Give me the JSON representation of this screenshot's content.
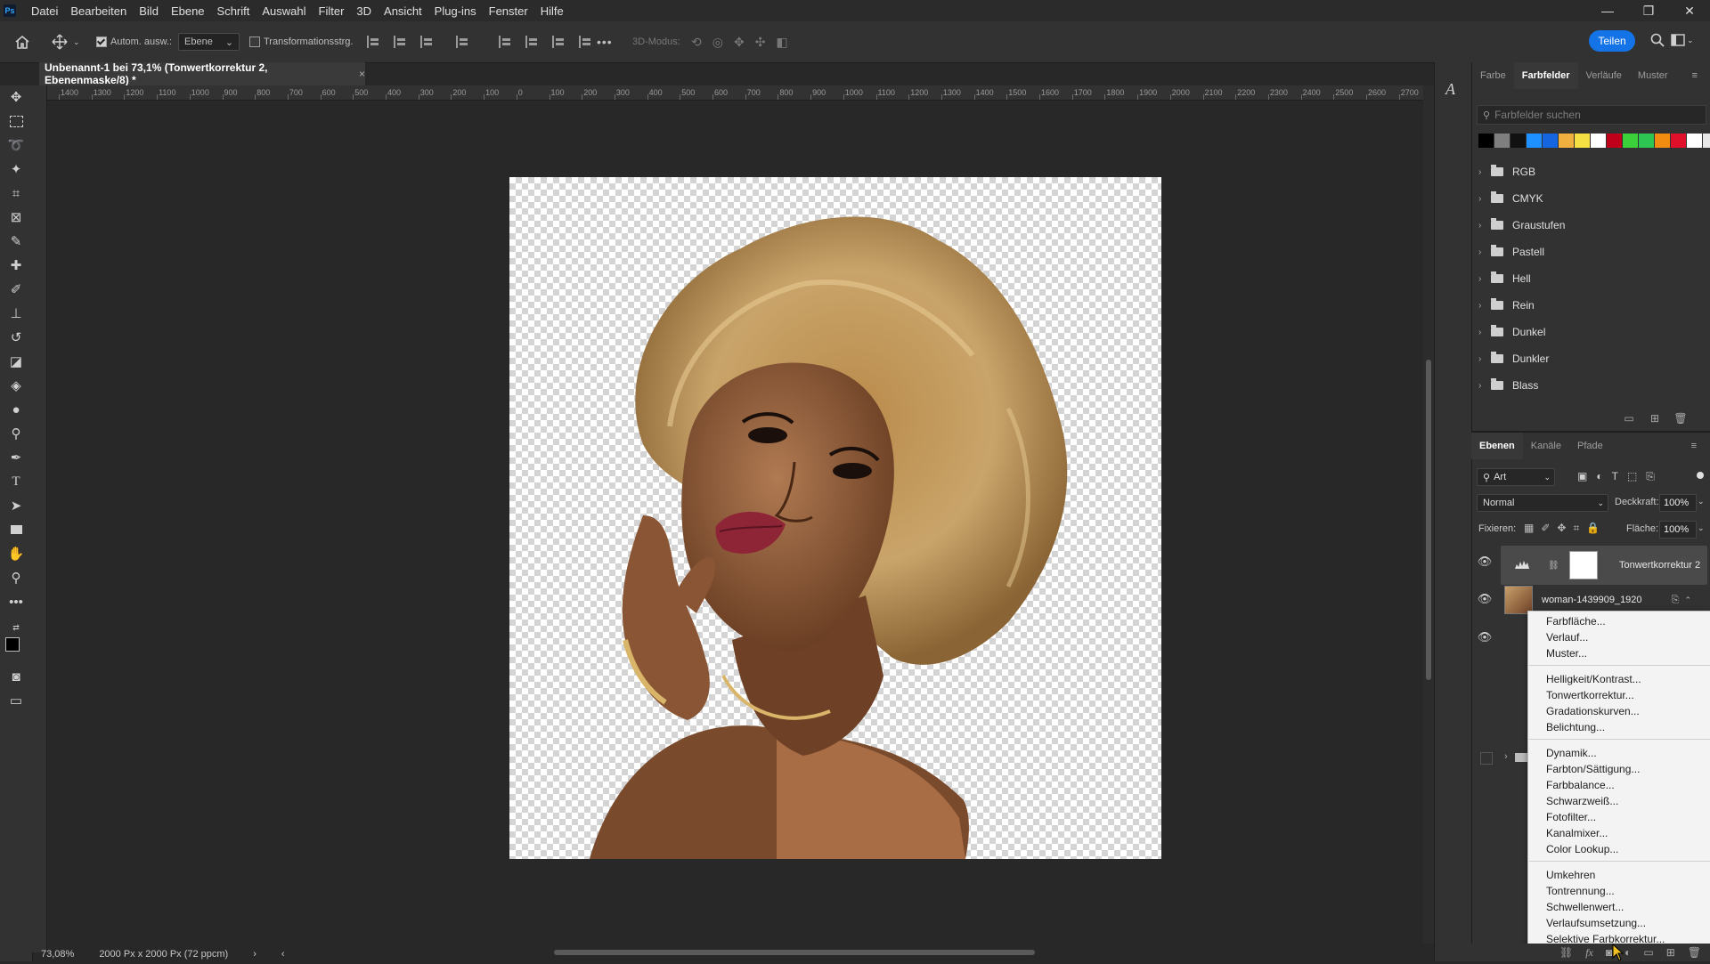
{
  "menubar": {
    "logo": "Ps",
    "items": [
      "Datei",
      "Bearbeiten",
      "Bild",
      "Ebene",
      "Schrift",
      "Auswahl",
      "Filter",
      "3D",
      "Ansicht",
      "Plug-ins",
      "Fenster",
      "Hilfe"
    ],
    "window_controls": [
      "—",
      "❐",
      "✕"
    ]
  },
  "options": {
    "auto_select_label": "Autom. ausw.:",
    "auto_select_checked": true,
    "auto_select_value": "Ebene",
    "transform_label": "Transformationsstrg.",
    "transform_checked": false,
    "more": "•••",
    "mode3d_label": "3D-Modus:",
    "share_label": "Teilen"
  },
  "document": {
    "tab_title": "Unbenannt-1 bei 73,1% (Tonwertkorrektur 2, Ebenenmaske/8) *",
    "close": "×",
    "zoom": "73,08%",
    "size_info": "2000 Px x 2000 Px (72 ppcm)",
    "status_arrow": "›",
    "scroll_left": "‹"
  },
  "ruler": {
    "h_labels": [
      "1400",
      "1300",
      "1200",
      "1100",
      "1000",
      "900",
      "800",
      "700",
      "600",
      "500",
      "400",
      "300",
      "200",
      "100",
      "0",
      "100",
      "200",
      "300",
      "400",
      "500",
      "600",
      "700",
      "800",
      "900",
      "1000",
      "1100",
      "1200",
      "1300",
      "1400",
      "1500",
      "1600",
      "1700",
      "1800",
      "1900",
      "2000",
      "2100",
      "2200",
      "2300",
      "2400",
      "2500",
      "2600",
      "2700"
    ]
  },
  "tools": [
    "move-tool",
    "marquee-tool",
    "lasso-tool",
    "magic-wand-tool",
    "crop-tool",
    "frame-tool",
    "eyedropper-tool",
    "healing-tool",
    "brush-tool",
    "stamp-tool",
    "history-brush-tool",
    "eraser-tool",
    "fill-tool",
    "blur-tool",
    "dodge-tool",
    "pen-tool",
    "type-tool",
    "path-select-tool",
    "rectangle-tool",
    "hand-tool",
    "zoom-tool",
    "more-tools"
  ],
  "swatch_panel": {
    "tabs": [
      "Farbe",
      "Farbfelder",
      "Verläufe",
      "Muster"
    ],
    "active_tab": "Farbfelder",
    "search_placeholder": "Farbfelder suchen",
    "swatch_colors": [
      "#000000",
      "#7f7f7f",
      "#111111",
      "#1e90ff",
      "#1565e0",
      "#f0b040",
      "#f5e043",
      "#ffffff",
      "#c0001a",
      "#3ad13a",
      "#2dc653",
      "#f28c10",
      "#e0102a",
      "#ffffff",
      "#e8e8e8"
    ],
    "folders": [
      "RGB",
      "CMYK",
      "Graustufen",
      "Pastell",
      "Hell",
      "Rein",
      "Dunkel",
      "Dunkler",
      "Blass"
    ]
  },
  "layers_panel": {
    "tabs": [
      "Ebenen",
      "Kanäle",
      "Pfade"
    ],
    "active_tab": "Ebenen",
    "filter_label": "Art",
    "blend_mode": "Normal",
    "opacity_label": "Deckkraft:",
    "opacity_value": "100%",
    "lock_label": "Fixieren:",
    "fill_label": "Fläche:",
    "fill_value": "100%",
    "layers": [
      {
        "name": "Tonwertkorrektur 2",
        "selected": true
      },
      {
        "name": "woman-1439909_1920",
        "selected": false
      }
    ]
  },
  "context_menu": {
    "groups": [
      [
        "Farbfläche...",
        "Verlauf...",
        "Muster..."
      ],
      [
        "Helligkeit/Kontrast...",
        "Tonwertkorrektur...",
        "Gradationskurven...",
        "Belichtung..."
      ],
      [
        "Dynamik...",
        "Farbton/Sättigung...",
        "Farbbalance...",
        "Schwarzweiß...",
        "Fotofilter...",
        "Kanalmixer...",
        "Color Lookup..."
      ],
      [
        "Umkehren",
        "Tontrennung...",
        "Schwellenwert...",
        "Verlaufsumsetzung...",
        "Selektive Farbkorrektur..."
      ]
    ]
  },
  "colors": {
    "accent": "#1473e6",
    "panel_bg": "#323232",
    "workspace_bg": "#282828"
  }
}
